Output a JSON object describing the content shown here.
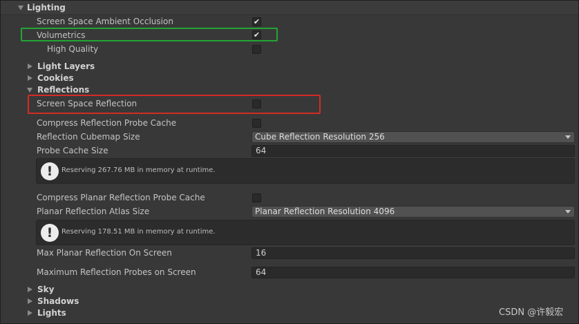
{
  "lighting": {
    "title": "Lighting",
    "ssao": {
      "label": "Screen Space Ambient Occlusion",
      "checked": true
    },
    "volumetrics": {
      "label": "Volumetrics",
      "checked": true
    },
    "high_quality": {
      "label": "High Quality",
      "checked": false
    },
    "light_layers": "Light Layers",
    "cookies": "Cookies",
    "reflections": {
      "title": "Reflections",
      "ssr": {
        "label": "Screen Space Reflection",
        "checked": false
      },
      "compress_probe_cache": {
        "label": "Compress Reflection Probe Cache",
        "checked": false
      },
      "cubemap_size": {
        "label": "Reflection Cubemap Size",
        "value": "Cube Reflection Resolution 256"
      },
      "probe_cache_size": {
        "label": "Probe Cache Size",
        "value": "64"
      },
      "probe_help": "Reserving 267.76 MB in memory at runtime.",
      "compress_planar_cache": {
        "label": "Compress Planar Reflection Probe Cache",
        "checked": false
      },
      "planar_atlas_size": {
        "label": "Planar Reflection Atlas Size",
        "value": "Planar Reflection Resolution 4096"
      },
      "planar_help": "Reserving 178.51 MB in memory at runtime.",
      "max_planar": {
        "label": "Max Planar Reflection On Screen",
        "value": "16"
      },
      "max_probes": {
        "label": "Maximum Reflection Probes on Screen",
        "value": "64"
      }
    },
    "sky": "Sky",
    "shadows": "Shadows",
    "lights": "Lights"
  },
  "icons": {
    "check": "✔",
    "warning": "!"
  },
  "highlight_colors": {
    "green": "#22a535",
    "red": "#d32c25"
  },
  "watermark": "CSDN @许毅宏"
}
